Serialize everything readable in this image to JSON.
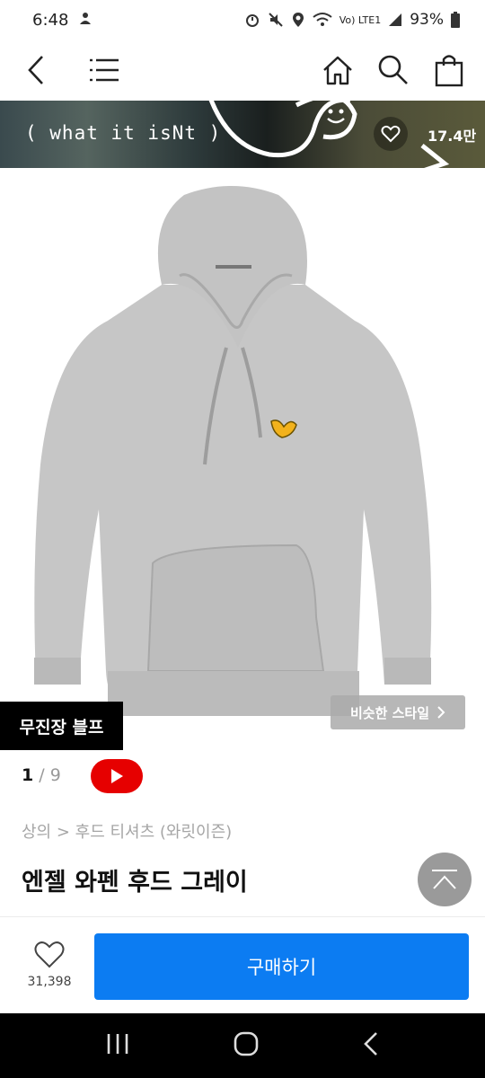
{
  "status": {
    "time": "6:48",
    "battery": "93%",
    "network_label": "Vo) LTE1"
  },
  "header": {
    "icons": [
      "back-icon",
      "menu-icon",
      "home-icon",
      "search-icon",
      "cart-icon"
    ]
  },
  "brand": {
    "name": "( what it isNt )",
    "likes": "17.4만"
  },
  "gallery": {
    "similar_style_label": "비슷한 스타일",
    "badge": "무진장 블프",
    "current_page": "1",
    "separator": "/",
    "total_pages": "9"
  },
  "product": {
    "breadcrumb": "상의 > 후드 티셔츠 (와릿이즌)",
    "title": "엔젤 와펜 후드 그레이"
  },
  "actions": {
    "wish_count": "31,398",
    "buy_label": "구매하기"
  },
  "colors": {
    "buy_button": "#0c7cf2",
    "youtube": "#e60000",
    "hoodie": "#c6c6c6",
    "patch": "#f2b21c"
  }
}
